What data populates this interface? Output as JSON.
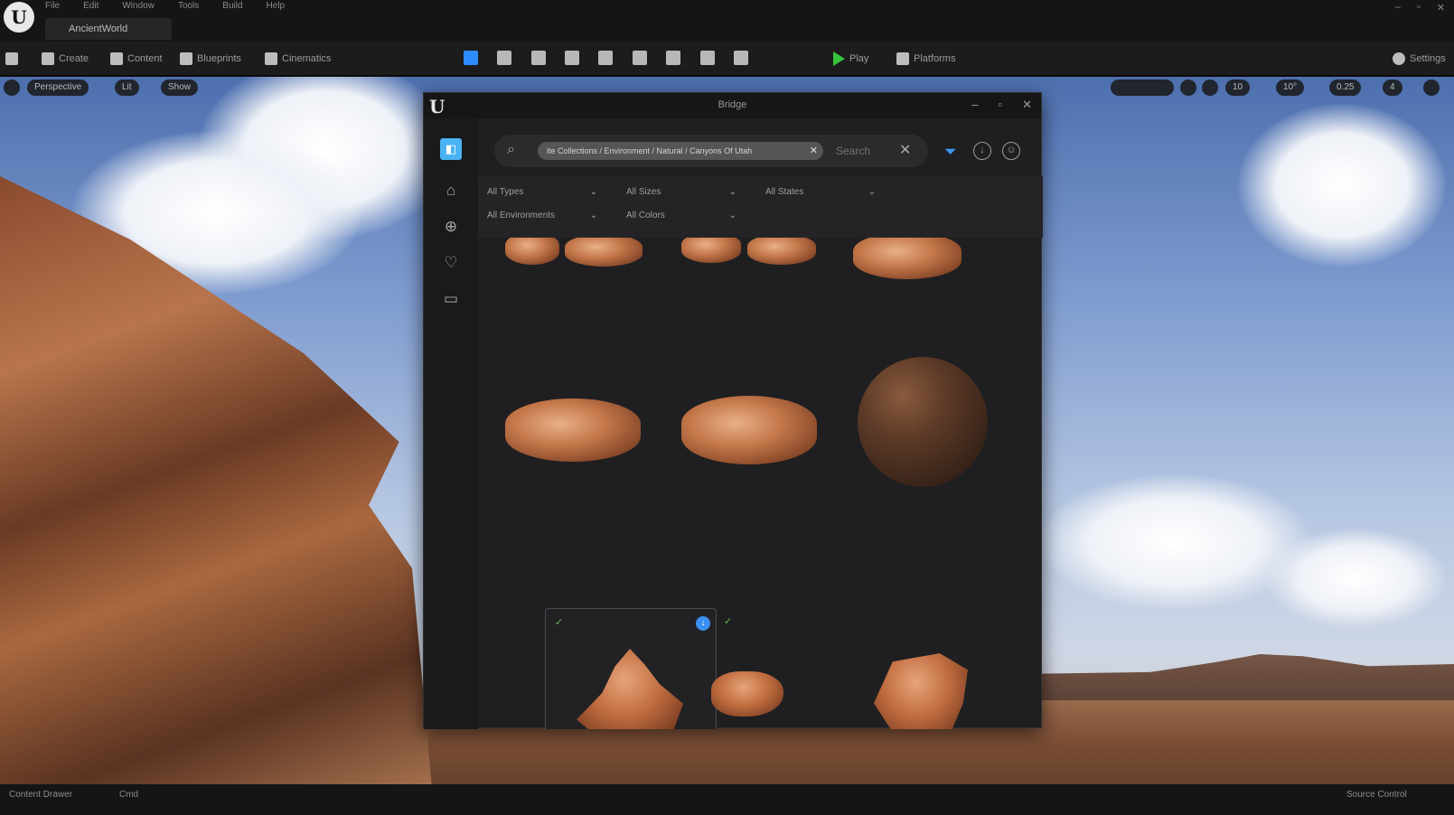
{
  "app": {
    "logo_text": "U",
    "menu": [
      "File",
      "Edit",
      "Window",
      "Tools",
      "Build",
      "Help"
    ],
    "project_tab": "AncientWorld",
    "window_controls": [
      "–",
      "▫",
      "✕"
    ]
  },
  "toolbar": {
    "save_icon": "save-icon",
    "create_label": "Create",
    "content_label": "Content",
    "blueprints_label": "Blueprints",
    "cinematics_label": "Cinematics",
    "play_label": "Play",
    "platforms_label": "Platforms",
    "settings_label": "Settings",
    "accent_color": "#2f8cff",
    "play_color": "#37c43a"
  },
  "viewport": {
    "perspective_label": "Perspective",
    "lit_label": "Lit",
    "show_label": "Show",
    "grid_snap": "10",
    "rot_snap": "10°",
    "scale_snap": "0.25",
    "camera_speed": "4"
  },
  "bridge": {
    "logo_text": "U",
    "title": "Bridge",
    "window_controls": [
      "–",
      "▫",
      "✕"
    ],
    "search": {
      "chip_text": "ite Collections / Environment / Natural / Canyons Of Utah",
      "placeholder": "Search"
    },
    "filters": [
      "All Types",
      "All Sizes",
      "All States",
      "All Environments",
      "All Colors"
    ],
    "accent_color": "#4ab3f4"
  },
  "statusbar": {
    "content_drawer": "Content Drawer",
    "cmd": "Cmd",
    "source_control": "Source Control"
  }
}
